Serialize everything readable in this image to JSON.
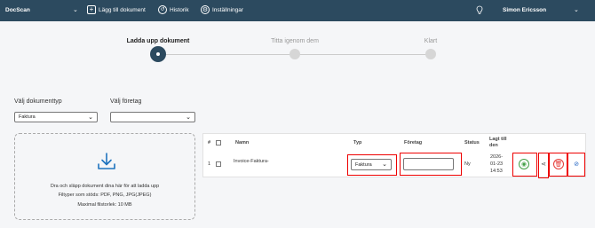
{
  "header": {
    "brand": "DocScan",
    "nav": [
      {
        "label": "Lägg till dokument",
        "icon": "plus-square-icon"
      },
      {
        "label": "Historik",
        "icon": "history-icon"
      },
      {
        "label": "Inställningar",
        "icon": "gear-icon"
      }
    ],
    "user": "Simon Ericsson"
  },
  "stepper": {
    "steps": [
      "Ladda upp dokument",
      "Titta igenom dem",
      "Klart"
    ],
    "active_index": 0
  },
  "form": {
    "doc_type_label": "Välj dokumenttyp",
    "doc_type_value": "Faktura",
    "company_label": "Välj företag",
    "company_value": ""
  },
  "dropzone": {
    "line1": "Dra och släpp dokument dina här för att ladda upp",
    "line2": "Filtyper som stöds: PDF, PNG, JPG(JPEG)",
    "line3": "Maximal filstorlek: 10 MB"
  },
  "table": {
    "headers": {
      "num": "#",
      "name": "Namn",
      "type": "Typ",
      "company": "Företag",
      "status": "Status",
      "added": "Lagt till den"
    },
    "rows": [
      {
        "num": "1",
        "name": "Invoice-Faktura-",
        "type": "Faktura",
        "company": "",
        "status": "Ny",
        "date": "2026-",
        "date2": "01-23",
        "time": "14:53"
      }
    ]
  },
  "colors": {
    "topbar": "#2c4a5f",
    "highlight": "#e00000",
    "delete": "#e53935",
    "view": "#43a047",
    "link": "#1e63c4"
  }
}
